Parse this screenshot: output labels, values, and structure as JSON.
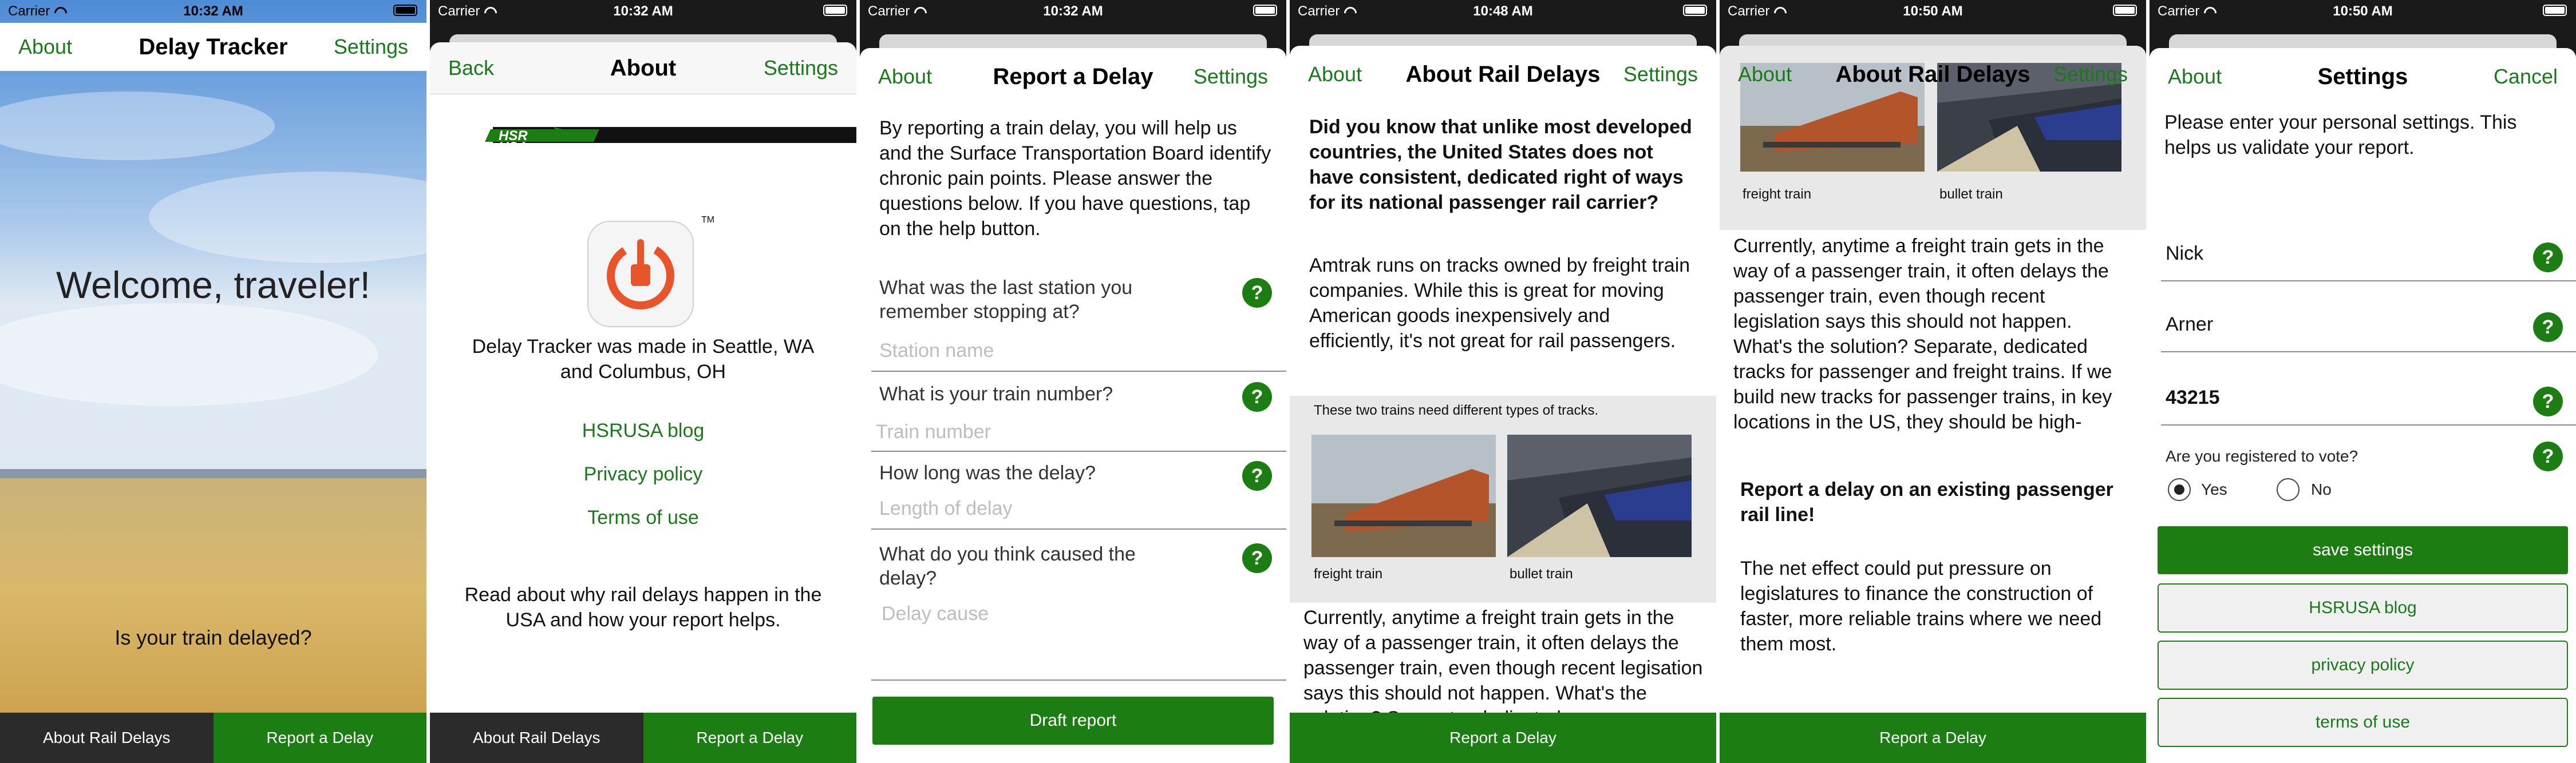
{
  "status": {
    "carrier": "Carrier"
  },
  "screens": {
    "home": {
      "time": "10:32 AM",
      "nav_left": "About",
      "title": "Delay Tracker",
      "nav_right": "Settings",
      "welcome": "Welcome, traveler!",
      "question": "Is your train delayed?"
    },
    "about": {
      "time": "10:32 AM",
      "nav_left": "Back",
      "title": "About",
      "nav_right": "Settings",
      "logo_text": "HSR USA",
      "trademark": "TM",
      "made_in": "Delay Tracker was made in Seattle, WA and Columbus, OH",
      "links": [
        "HSRUSA blog",
        "Privacy policy",
        "Terms of use"
      ],
      "read_more": "Read about why rail delays happen in the USA and how your report helps."
    },
    "report": {
      "time": "10:32 AM",
      "nav_left": "About",
      "title": "Report a Delay",
      "nav_right": "Settings",
      "intro": "By reporting a train delay, you will help us and the Surface Transportation Board identify chronic pain points. Please answer the questions below.  If you have questions, tap on the help button.",
      "questions": [
        {
          "label": "What was the last station you remember stopping at?",
          "placeholder": "Station name"
        },
        {
          "label": "What is your train number?",
          "placeholder": "Train number"
        },
        {
          "label": "How long was the delay?",
          "placeholder": "Length of delay"
        },
        {
          "label": "What do you think caused the delay?",
          "placeholder": "Delay cause"
        }
      ],
      "help": "?",
      "button": "Draft report"
    },
    "rail1": {
      "time": "10:48 AM",
      "nav_left": "About",
      "title": "About Rail Delays",
      "nav_right": "Settings",
      "bold_para": "Did you know that unlike most developed countries, the United States does not have consistent, dedicated right of ways for its national passenger rail carrier?",
      "para2": "Amtrak runs on tracks owned by freight train companies. While this is great for moving American goods inexpensively and efficiently, it's not great for rail passengers.",
      "photo_heading": "These two trains need different types of tracks.",
      "caption_freight": "freight train",
      "caption_bullet": "bullet train",
      "para3": "Currently, anytime a freight train gets in the way of a passenger train, it often delays the passenger train, even though recent legisation says this should not happen. What's the solution? Separate, dedicated",
      "tab_report": "Report a Delay"
    },
    "rail2": {
      "time": "10:50 AM",
      "nav_left": "About",
      "title": "About Rail Delays",
      "nav_right": "Settings",
      "caption_freight": "freight train",
      "caption_bullet": "bullet train",
      "para": "Currently, anytime a freight train gets in the way of a passenger train, it often delays the passenger train, even though recent legislation says this should not happen. What's the solution? Separate, dedicated tracks for passenger and freight trains. If we build new tracks for passenger trains, in key locations in the US, they should be high-",
      "bold_link": "Report a delay on an existing passenger rail line!",
      "para2": "The net effect could put pressure on legislatures to finance the construction of faster, more reliable trains where we need them most.",
      "tab_report": "Report a Delay"
    },
    "settings": {
      "time": "10:50 AM",
      "nav_left": "About",
      "title": "Settings",
      "nav_right": "Cancel",
      "intro": "Please enter your personal settings. This helps us validate your report.",
      "first_name": "Nick",
      "last_name": "Arner",
      "zip": "43215",
      "vote_question": "Are you registered to vote?",
      "vote_yes": "Yes",
      "vote_no": "No",
      "vote_selected": "Yes",
      "save": "save settings",
      "buttons": [
        "HSRUSA blog",
        "privacy policy",
        "terms of use"
      ]
    }
  },
  "tabs": {
    "about_rail": "About Rail Delays",
    "report": "Report a Delay"
  },
  "colors": {
    "accent": "#1b7d12",
    "tab_dark": "#2b2b2b"
  }
}
